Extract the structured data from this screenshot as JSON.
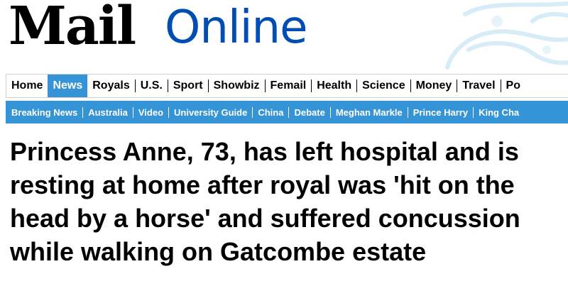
{
  "logo": {
    "brand_primary": "Mail",
    "brand_secondary": "Online",
    "color_primary": "#000000",
    "color_secondary": "#004db3"
  },
  "nav_primary": {
    "items": [
      {
        "label": "Home"
      },
      {
        "label": "News",
        "active": true
      },
      {
        "label": "Royals"
      },
      {
        "label": "U.S."
      },
      {
        "label": "Sport"
      },
      {
        "label": "Showbiz"
      },
      {
        "label": "Femail"
      },
      {
        "label": "Health"
      },
      {
        "label": "Science"
      },
      {
        "label": "Money"
      },
      {
        "label": "Travel"
      },
      {
        "label": "Po"
      }
    ]
  },
  "nav_secondary": {
    "items": [
      {
        "label": "Breaking News"
      },
      {
        "label": "Australia"
      },
      {
        "label": "Video"
      },
      {
        "label": "University Guide"
      },
      {
        "label": "China"
      },
      {
        "label": "Debate"
      },
      {
        "label": "Meghan Markle"
      },
      {
        "label": "Prince Harry"
      },
      {
        "label": "King Cha"
      }
    ]
  },
  "article": {
    "headline": "Princess Anne, 73, has left hospital and is resting at home after royal was 'hit on the head by a horse' and suffered concussion while walking on Gatcombe estate"
  },
  "colors": {
    "accent": "#3594d6",
    "text": "#000000",
    "background": "#ffffff"
  }
}
